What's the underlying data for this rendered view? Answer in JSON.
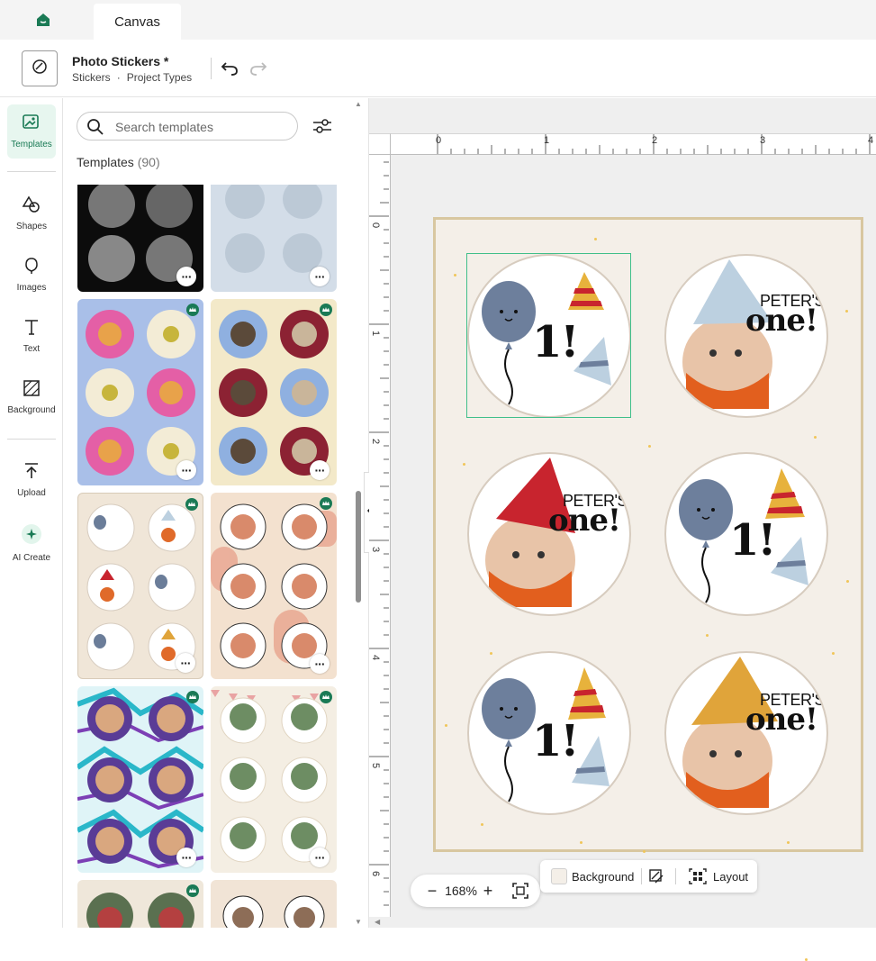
{
  "tabs": {
    "home_icon": "home-icon",
    "active_tab": "Canvas"
  },
  "project": {
    "title": "Photo Stickers *",
    "category": "Stickers",
    "separator": "·",
    "type": "Project Types"
  },
  "rail": {
    "items": [
      {
        "label": "Templates",
        "icon": "templates-icon",
        "active": true
      },
      {
        "label": "Shapes",
        "icon": "shapes-icon"
      },
      {
        "label": "Images",
        "icon": "images-icon"
      },
      {
        "label": "Text",
        "icon": "text-icon"
      },
      {
        "label": "Background",
        "icon": "background-icon"
      },
      {
        "label": "Upload",
        "icon": "upload-icon"
      },
      {
        "label": "AI Create",
        "icon": "ai-create-icon"
      }
    ]
  },
  "panel": {
    "search_placeholder": "Search templates",
    "heading": "Templates",
    "count": "(90)",
    "more_label": "···"
  },
  "stickers": [
    {
      "headline": "1!",
      "name": "PETER'S",
      "subline": "one!"
    }
  ],
  "ruler": {
    "top": [
      "0",
      "1",
      "2",
      "3",
      "4"
    ],
    "left": [
      "0",
      "1",
      "2",
      "3",
      "4",
      "5",
      "6"
    ]
  },
  "toolbar": {
    "zoom_out": "−",
    "zoom_level": "168%",
    "zoom_in": "+",
    "background_label": "Background",
    "layout_label": "Layout"
  },
  "colors": {
    "accent": "#1a7a55",
    "mat_border": "#d8c7a0",
    "mat_fill": "#f4efe8",
    "selection": "#3fbf8a"
  }
}
